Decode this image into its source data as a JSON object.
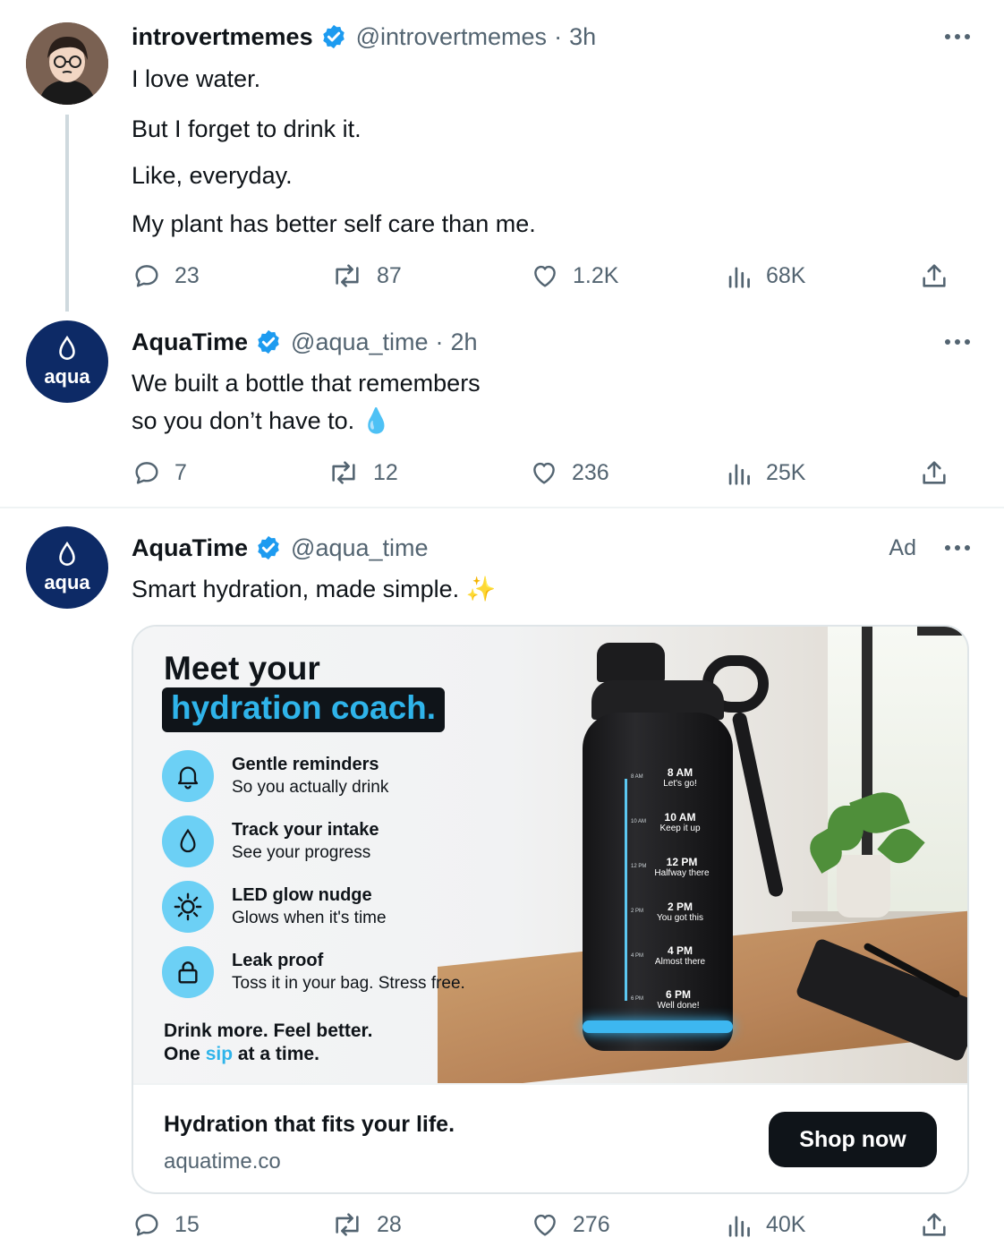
{
  "tweets": [
    {
      "name": "introvertmemes",
      "handle": "@introvertmemes",
      "time": "3h",
      "lines": [
        "I love water.",
        "But I forget to drink it.",
        "Like, everyday.",
        "My plant has better self care than me."
      ],
      "replies": "23",
      "retweets": "87",
      "likes": "1.2K",
      "views": "68K"
    },
    {
      "name": "AquaTime",
      "handle": "@aqua_time",
      "time": "2h",
      "avatar_text": "aqua",
      "lines": [
        "We built a bottle that remembers",
        "so you don’t have to."
      ],
      "emoji": "💧",
      "replies": "7",
      "retweets": "12",
      "likes": "236",
      "views": "25K"
    },
    {
      "name": "AquaTime",
      "handle": "@aqua_time",
      "ad_label": "Ad",
      "avatar_text": "aqua",
      "text": "Smart hydration, made simple.",
      "emoji": "✨",
      "replies": "15",
      "retweets": "28",
      "likes": "276",
      "views": "40K"
    }
  ],
  "ad_card": {
    "headline_line1": "Meet your",
    "headline_line2": "hydration coach.",
    "features": [
      {
        "title": "Gentle reminders",
        "subtitle": "So you actually drink",
        "icon": "bell-icon"
      },
      {
        "title": "Track your intake",
        "subtitle": "See your progress",
        "icon": "droplet-icon"
      },
      {
        "title": "LED glow nudge",
        "subtitle": "Glows when it's time",
        "icon": "sun-icon"
      },
      {
        "title": "Leak proof",
        "subtitle": "Toss it in your bag. Stress free.",
        "icon": "lock-icon"
      }
    ],
    "tagline_line1": "Drink more. Feel better.",
    "tagline_line2_pre": "One",
    "tagline_line2_highlight": "sip",
    "tagline_line2_post": "at a time.",
    "bottle_schedule": [
      {
        "small": "8 AM",
        "time": "8 AM",
        "note": "Let's go!"
      },
      {
        "small": "10 AM",
        "time": "10 AM",
        "note": "Keep it up"
      },
      {
        "small": "12 PM",
        "time": "12 PM",
        "note": "Halfway there"
      },
      {
        "small": "2 PM",
        "time": "2 PM",
        "note": "You got this"
      },
      {
        "small": "4 PM",
        "time": "4 PM",
        "note": "Almost there"
      },
      {
        "small": "6 PM",
        "time": "6 PM",
        "note": "Well done!"
      }
    ],
    "footer_title": "Hydration that fits your life.",
    "footer_domain": "aquatime.co",
    "cta_label": "Shop now"
  },
  "colors": {
    "verified": "#1d9bf0",
    "brand_navy": "#0d2a66",
    "accent_cyan": "#2fb4ea",
    "muted": "#536471"
  }
}
